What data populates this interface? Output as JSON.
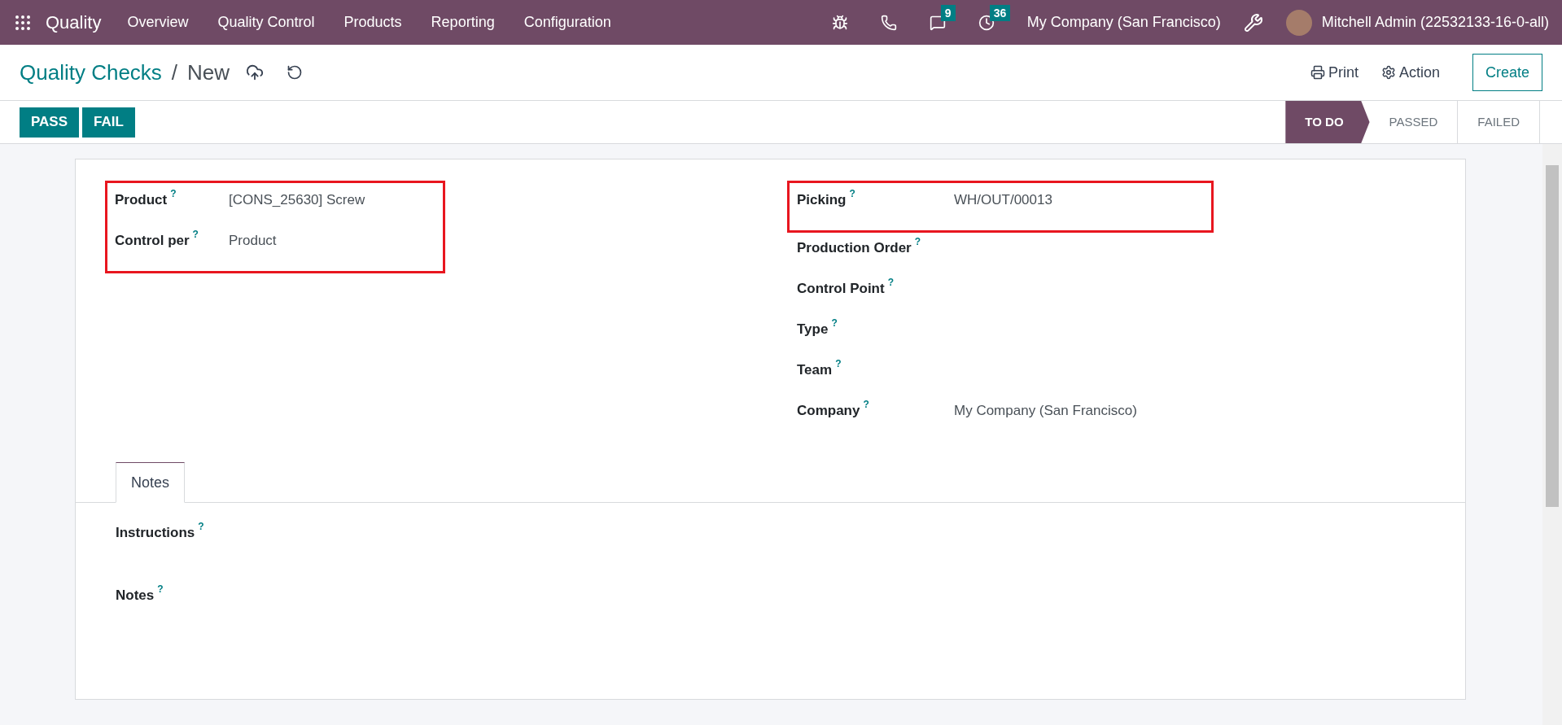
{
  "navbar": {
    "app": "Quality",
    "menu": [
      "Overview",
      "Quality Control",
      "Products",
      "Reporting",
      "Configuration"
    ],
    "systray": [
      {
        "kind": "bug"
      },
      {
        "kind": "phone"
      },
      {
        "kind": "chat",
        "badge": "9"
      },
      {
        "kind": "activity",
        "badge": "36"
      }
    ],
    "company": "My Company (San Francisco)",
    "user": "Mitchell Admin (22532133-16-0-all)"
  },
  "breadcrumb": {
    "parent": "Quality Checks",
    "separator": "/",
    "current": "New"
  },
  "actions": {
    "print": "Print",
    "action": "Action",
    "create": "Create"
  },
  "buttons": [
    "PASS",
    "FAIL"
  ],
  "status_steps": [
    {
      "label": "TO DO",
      "selected": true
    },
    {
      "label": "PASSED",
      "selected": false
    },
    {
      "label": "FAILED",
      "selected": false
    }
  ],
  "left_groups": [
    {
      "highlighted": true,
      "fields": [
        {
          "label": "Product",
          "help": "?",
          "value": "[CONS_25630] Screw"
        },
        {
          "label": "Control per",
          "help": "?",
          "value": "Product"
        }
      ]
    }
  ],
  "right_groups": [
    {
      "highlighted": true,
      "fields": [
        {
          "label": "Picking",
          "help": "?",
          "value": "WH/OUT/00013"
        }
      ]
    },
    {
      "highlighted": false,
      "fields": [
        {
          "label": "Production Order",
          "help": "?"
        },
        {
          "label": "Control Point",
          "help": "?"
        },
        {
          "label": "Type",
          "help": "?"
        },
        {
          "label": "Team",
          "help": "?"
        },
        {
          "label": "Company",
          "help": "?",
          "value": "My Company (San Francisco)"
        }
      ]
    }
  ],
  "tabs": [
    {
      "label": "Notes",
      "selected": true
    }
  ],
  "notes_fields": [
    {
      "label": "Instructions",
      "help": "?"
    },
    {
      "label": "Notes",
      "help": "?"
    }
  ]
}
